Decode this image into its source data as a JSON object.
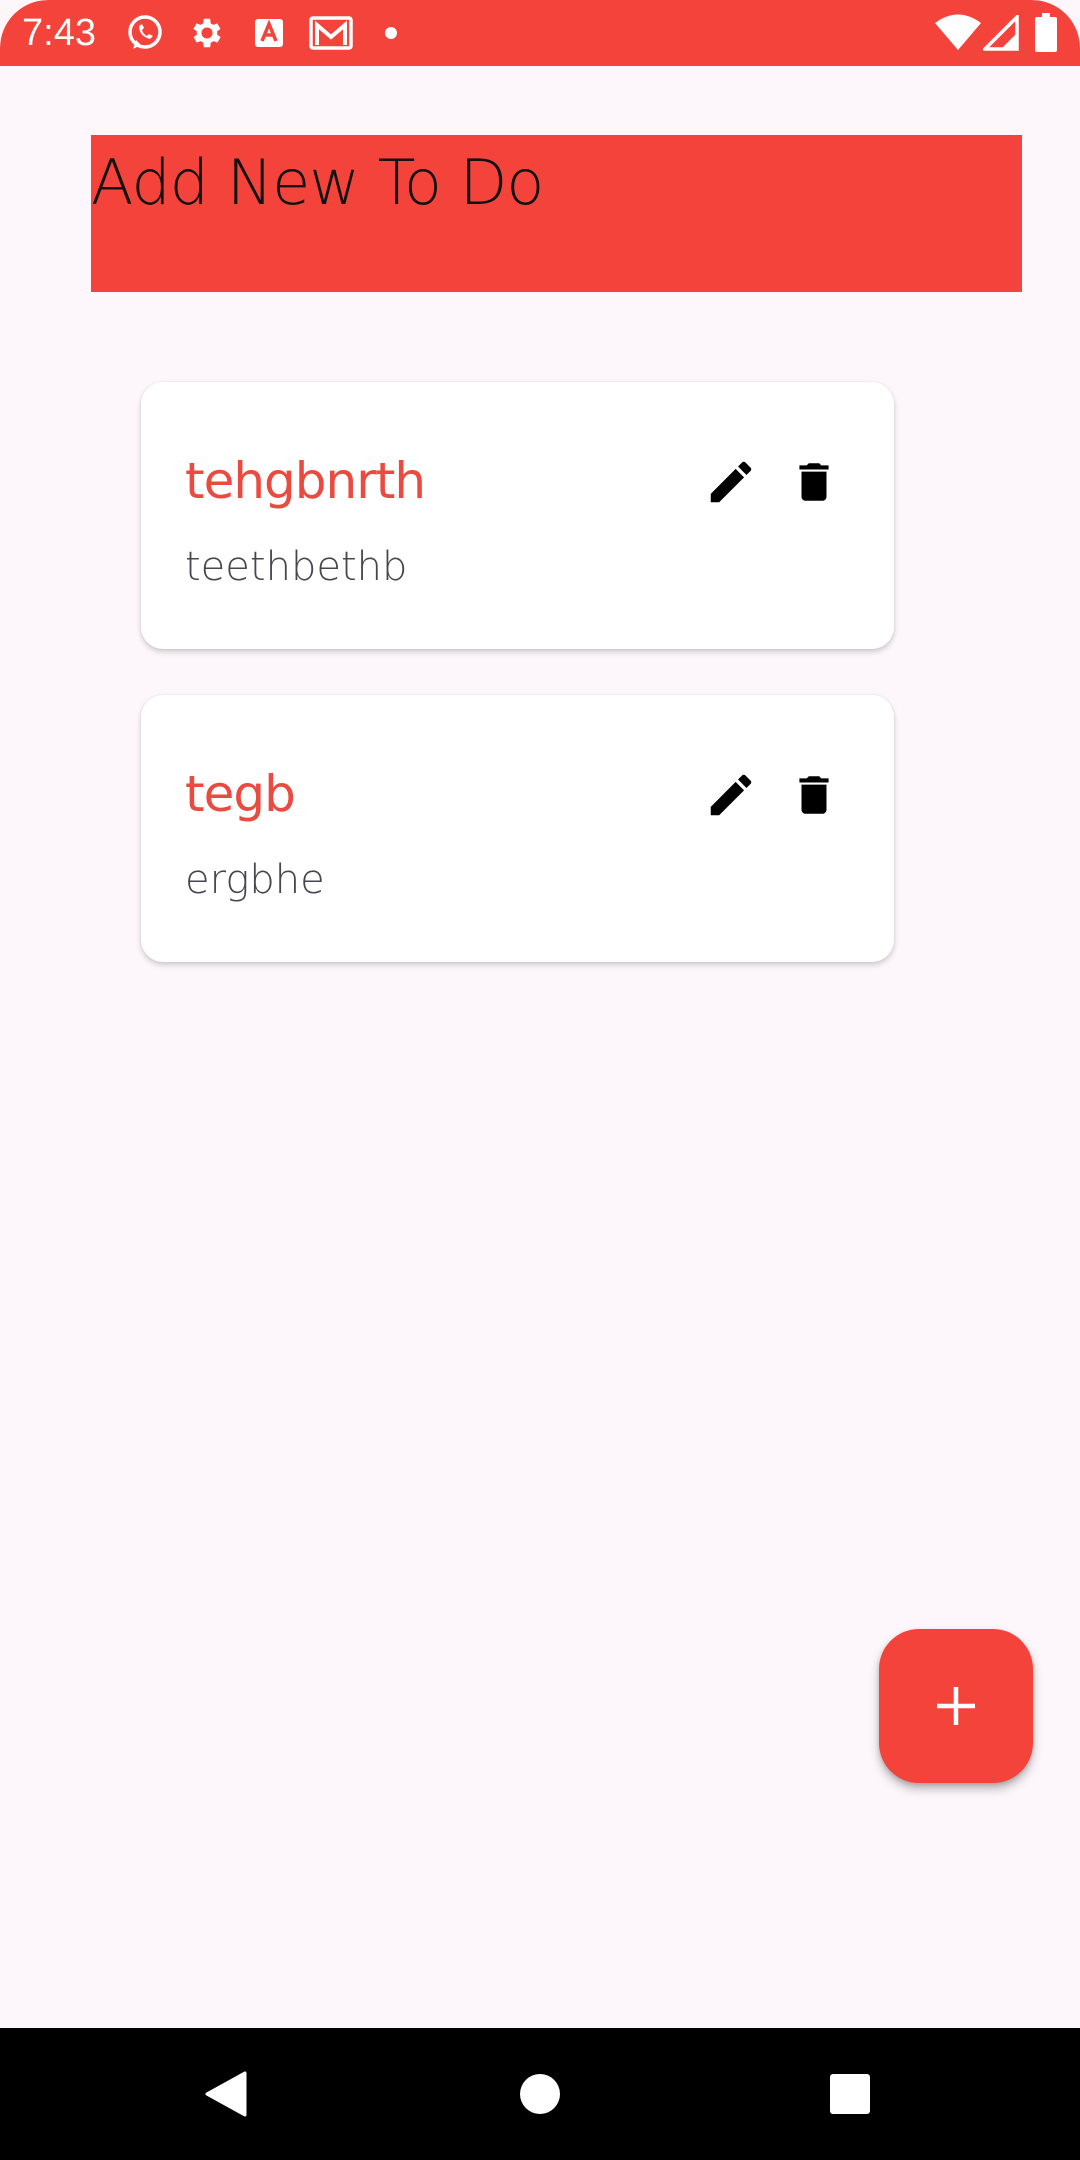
{
  "status_bar": {
    "time": "7:43",
    "background_color": "#f4433b",
    "left_icons": [
      "whatsapp-icon",
      "settings-gear-icon",
      "text-a-icon",
      "gmail-icon",
      "notification-dot-icon"
    ],
    "right_icons": [
      "wifi-icon",
      "cellular-signal-icon",
      "battery-icon"
    ]
  },
  "header": {
    "title": "Add New To Do",
    "background_color": "#f4433b"
  },
  "todos": [
    {
      "title": "tehgbnrth",
      "description": "teethbethb",
      "edit_icon": "pencil-icon",
      "delete_icon": "trash-icon"
    },
    {
      "title": "tegb",
      "description": "ergbhe",
      "edit_icon": "pencil-icon",
      "delete_icon": "trash-icon"
    }
  ],
  "fab": {
    "icon": "plus-icon",
    "color": "#f4433b"
  },
  "nav_bar": {
    "buttons": [
      "back-icon",
      "home-icon",
      "recents-icon"
    ]
  },
  "colors": {
    "accent": "#f4433b",
    "title_text": "#ea4a3f",
    "background": "#fdf7fc"
  }
}
